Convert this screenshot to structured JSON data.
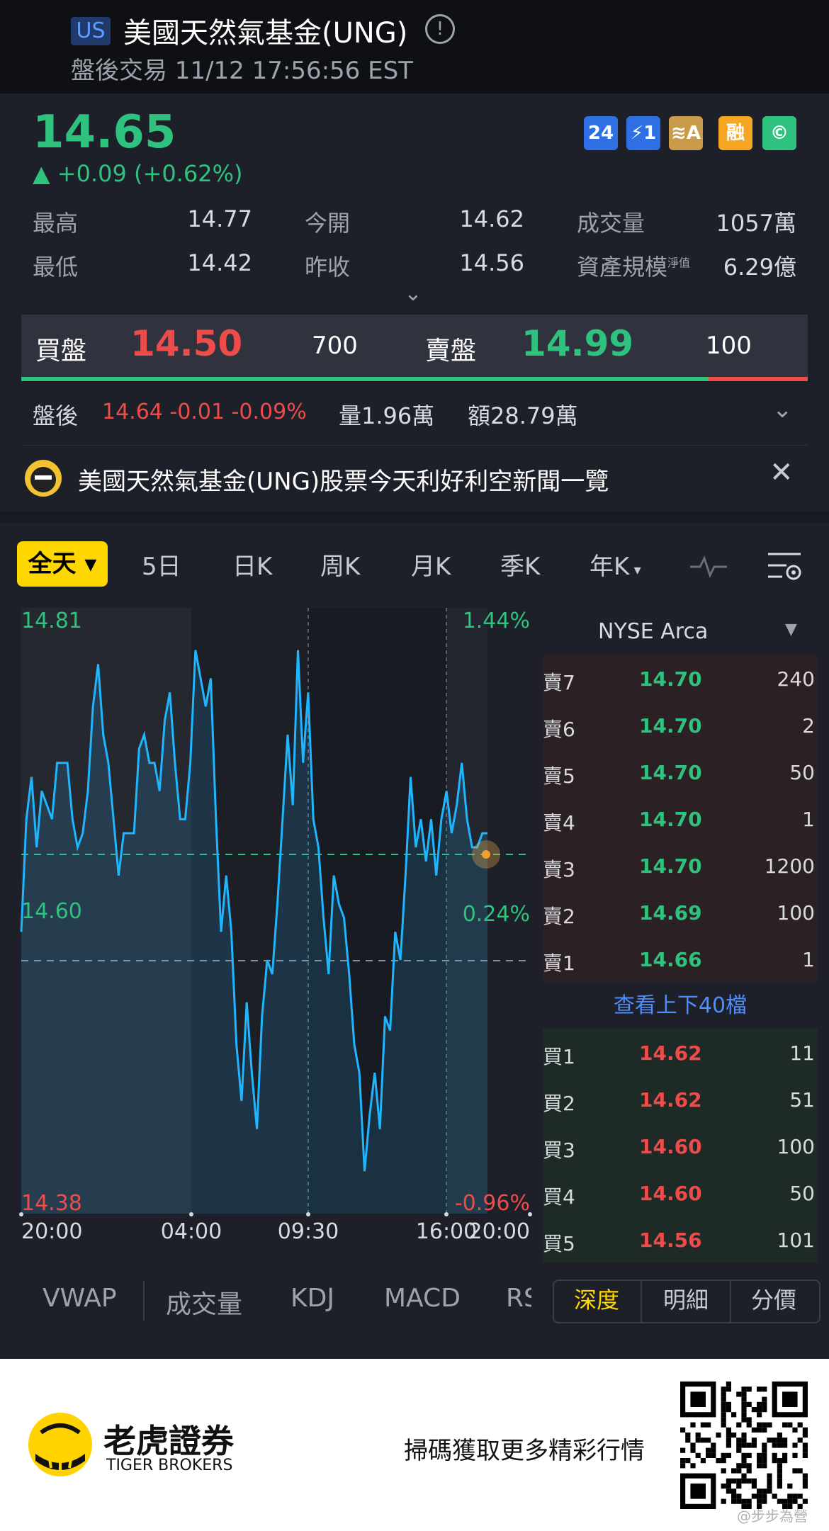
{
  "header": {
    "market_tag": "US",
    "title": "美國天然氣基金(UNG)",
    "info_icon": "info-icon",
    "subtitle": "盤後交易 11/12 17:56:56 EST"
  },
  "quote": {
    "price": "14.65",
    "change": "▲ +0.09 (+0.62%)",
    "badges": [
      {
        "label": "24",
        "color": "#2f6fe4",
        "name": "24h-badge-icon"
      },
      {
        "label": "⚡1",
        "color": "#2f6fe4",
        "name": "lightning-badge-icon"
      },
      {
        "label": "≋A",
        "color": "#c99a4a",
        "name": "layers-badge-icon"
      },
      {
        "label": "融",
        "color": "#f5a623",
        "name": "margin-badge-icon"
      },
      {
        "label": "©",
        "color": "#2ec27e",
        "name": "coin-badge-icon"
      }
    ],
    "stats": {
      "high_label": "最高",
      "high": "14.77",
      "open_label": "今開",
      "open": "14.62",
      "volume_label": "成交量",
      "volume": "1057萬",
      "low_label": "最低",
      "low": "14.42",
      "prev_close_label": "昨收",
      "prev_close": "14.56",
      "aum_label": "資產規模",
      "aum_sup": "淨值",
      "aum": "6.29億"
    },
    "bid_label": "買盤",
    "bid_price": "14.50",
    "bid_vol": "700",
    "ask_label": "賣盤",
    "ask_price": "14.99",
    "ask_vol": "100",
    "after_hours": {
      "label": "盤後",
      "value": "14.64 -0.01 -0.09%",
      "volume": "量1.96萬",
      "amount": "額28.79萬"
    },
    "news_text": "美國天然氣基金(UNG)股票今天利好利空新聞一覽"
  },
  "chart": {
    "periods": [
      "全天",
      "5日",
      "日K",
      "周K",
      "月K",
      "季K",
      "年K"
    ],
    "price_high": "14.81",
    "price_mid": "14.60",
    "price_low": "14.38",
    "pct_high": "1.44%",
    "pct_mid": "0.24%",
    "pct_low": "-0.96%",
    "time_labels": [
      "20:00",
      "04:00",
      "09:30",
      "16:00",
      "20:00"
    ],
    "indicators": [
      "VWAP",
      "成交量",
      "KDJ",
      "MACD",
      "RSI"
    ]
  },
  "chart_data": {
    "type": "line",
    "ylim": [
      14.38,
      14.81
    ],
    "reference_line": 14.56,
    "current_price": 14.65,
    "x_ticks": [
      "20:00",
      "04:00",
      "09:30",
      "16:00",
      "20:00"
    ],
    "series": [
      {
        "values": [
          14.58,
          14.66,
          14.69,
          14.64,
          14.68,
          14.67,
          14.66,
          14.7,
          14.7,
          14.7,
          14.66,
          14.64,
          14.65,
          14.68,
          14.74,
          14.77,
          14.72,
          14.7,
          14.66,
          14.62,
          14.65,
          14.65,
          14.65,
          14.71,
          14.72,
          14.7,
          14.7,
          14.68,
          14.73,
          14.75,
          14.7,
          14.66,
          14.66,
          14.7,
          14.78,
          14.76,
          14.74,
          14.76,
          14.66,
          14.58,
          14.62,
          14.58,
          14.5,
          14.46,
          14.53,
          14.48,
          14.44,
          14.52,
          14.56,
          14.55,
          14.6,
          14.66,
          14.72,
          14.67,
          14.78,
          14.7,
          14.75,
          14.66,
          14.64,
          14.59,
          14.55,
          14.62,
          14.6,
          14.59,
          14.55,
          14.5,
          14.48,
          14.41,
          14.45,
          14.48,
          14.44,
          14.52,
          14.51,
          14.58,
          14.56,
          14.62,
          14.69,
          14.64,
          14.66,
          14.63,
          14.66,
          14.62,
          14.66,
          14.68,
          14.65,
          14.67,
          14.7,
          14.66,
          14.64,
          14.64,
          14.65,
          14.65
        ]
      }
    ]
  },
  "order_book": {
    "exchange": "NYSE Arca",
    "asks": [
      {
        "label": "賣7",
        "price": "14.70",
        "size": "240"
      },
      {
        "label": "賣6",
        "price": "14.70",
        "size": "2"
      },
      {
        "label": "賣5",
        "price": "14.70",
        "size": "50"
      },
      {
        "label": "賣4",
        "price": "14.70",
        "size": "1"
      },
      {
        "label": "賣3",
        "price": "14.70",
        "size": "1200"
      },
      {
        "label": "賣2",
        "price": "14.69",
        "size": "100"
      },
      {
        "label": "賣1",
        "price": "14.66",
        "size": "1"
      }
    ],
    "more_label": "查看上下40檔",
    "bids": [
      {
        "label": "買1",
        "price": "14.62",
        "size": "11"
      },
      {
        "label": "買2",
        "price": "14.62",
        "size": "51"
      },
      {
        "label": "買3",
        "price": "14.60",
        "size": "100"
      },
      {
        "label": "買4",
        "price": "14.60",
        "size": "50"
      },
      {
        "label": "買5",
        "price": "14.56",
        "size": "101"
      }
    ],
    "tabs": [
      "深度",
      "明細",
      "分價"
    ]
  },
  "footer": {
    "brand_cn": "老虎證券",
    "brand_en": "TIGER BROKERS",
    "cta": "掃碼獲取更多精彩行情",
    "watermark": "@步步為營"
  },
  "colors": {
    "up": "#2ec27e",
    "down": "#ee4b4b",
    "line": "#1fb6ff",
    "active_tab": "#ffd700"
  }
}
